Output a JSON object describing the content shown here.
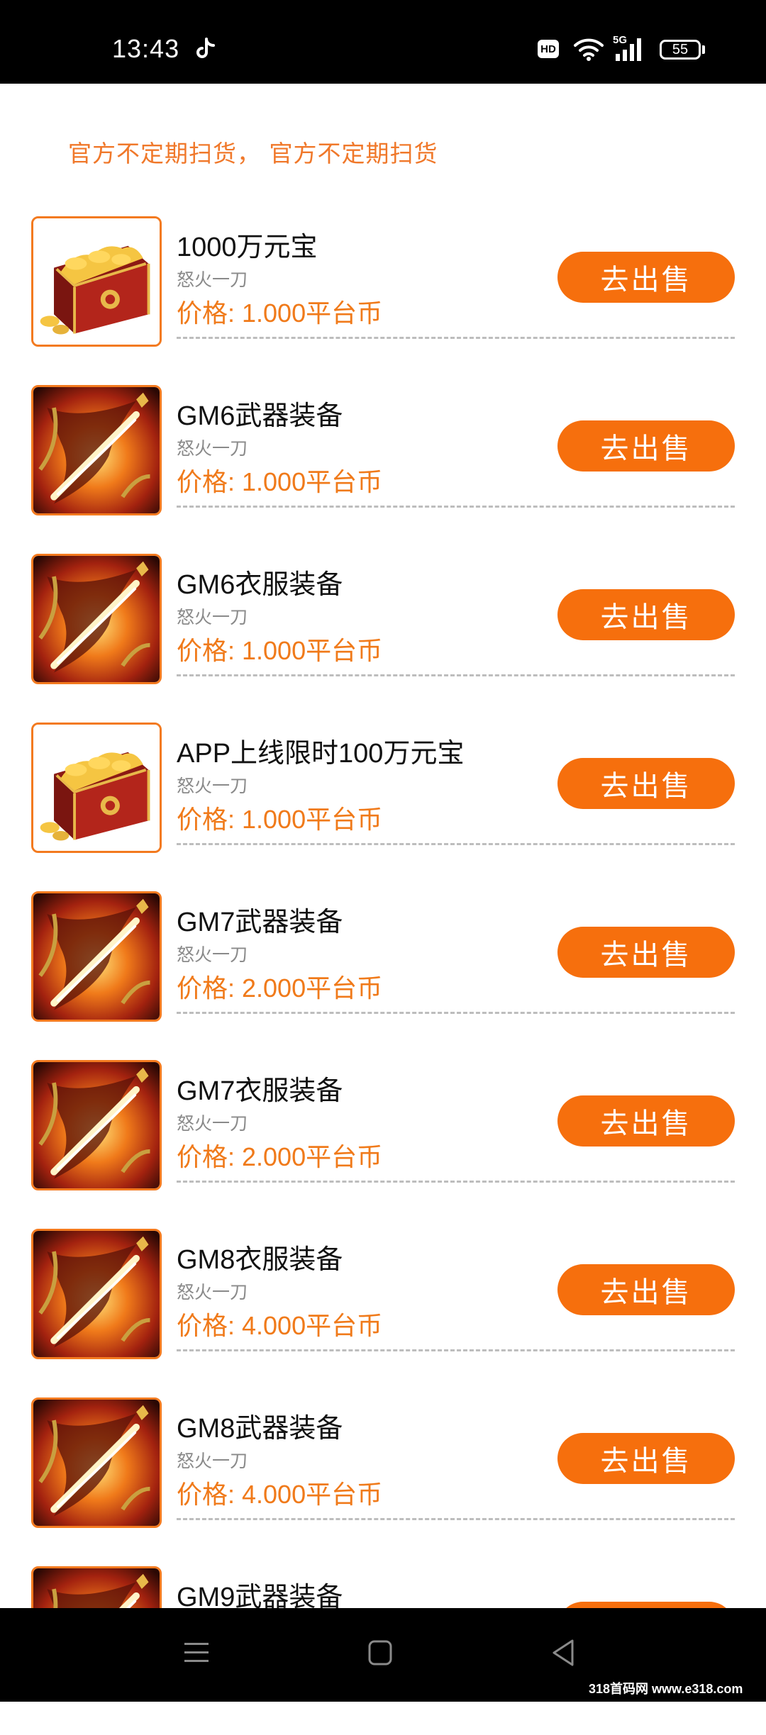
{
  "status_bar": {
    "time": "13:43",
    "hd": "HD",
    "network": "5G",
    "battery": "55"
  },
  "notice": "官方不定期扫货， 官方不定期扫货",
  "items": [
    {
      "title": "1000万元宝",
      "game": "怒火一刀",
      "price": "价格: 1.000平台币",
      "button": "去出售",
      "icon": "treasure-chest"
    },
    {
      "title": "GM6武器装备",
      "game": "怒火一刀",
      "price": "价格: 1.000平台币",
      "button": "去出售",
      "icon": "flame-blade"
    },
    {
      "title": "GM6衣服装备",
      "game": "怒火一刀",
      "price": "价格: 1.000平台币",
      "button": "去出售",
      "icon": "flame-blade"
    },
    {
      "title": "APP上线限时100万元宝",
      "game": "怒火一刀",
      "price": "价格: 1.000平台币",
      "button": "去出售",
      "icon": "treasure-chest"
    },
    {
      "title": "GM7武器装备",
      "game": "怒火一刀",
      "price": "价格: 2.000平台币",
      "button": "去出售",
      "icon": "flame-blade"
    },
    {
      "title": "GM7衣服装备",
      "game": "怒火一刀",
      "price": "价格: 2.000平台币",
      "button": "去出售",
      "icon": "flame-blade"
    },
    {
      "title": "GM8衣服装备",
      "game": "怒火一刀",
      "price": "价格: 4.000平台币",
      "button": "去出售",
      "icon": "flame-blade"
    },
    {
      "title": "GM8武器装备",
      "game": "怒火一刀",
      "price": "价格: 4.000平台币",
      "button": "去出售",
      "icon": "flame-blade"
    },
    {
      "title": "GM9武器装备",
      "game": "",
      "price": "",
      "button": "",
      "icon": "flame-blade"
    }
  ],
  "watermark": "318首码网 www.e318.com",
  "colors": {
    "accent": "#f66f0d",
    "price": "#f07a1a",
    "notice": "#f0782a"
  }
}
